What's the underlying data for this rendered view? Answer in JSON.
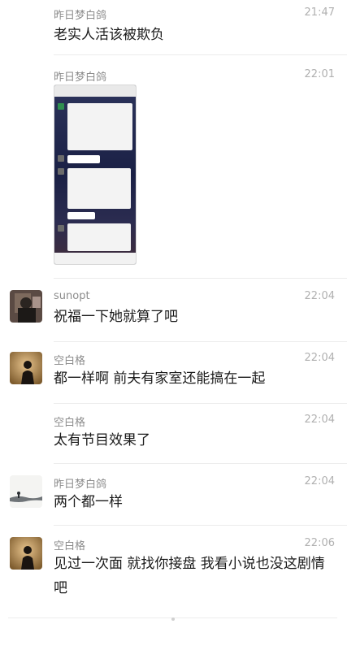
{
  "messages": [
    {
      "name": "昨日梦白鸽",
      "time": "21:47",
      "text": "老实人活该被欺负"
    },
    {
      "name": "昨日梦白鸽",
      "time": "22:01",
      "text": ""
    },
    {
      "name": "sunopt",
      "time": "22:04",
      "text": "祝福一下她就算了吧"
    },
    {
      "name": "空白格",
      "time": "22:04",
      "text": "都一样啊 前夫有家室还能搞在一起"
    },
    {
      "name": "空白格",
      "time": "22:04",
      "text": "太有节目效果了"
    },
    {
      "name": "昨日梦白鸽",
      "time": "22:04",
      "text": "两个都一样"
    },
    {
      "name": "空白格",
      "time": "22:06",
      "text": "见过一次面 就找你接盘 我看小说也没这剧情吧"
    }
  ]
}
